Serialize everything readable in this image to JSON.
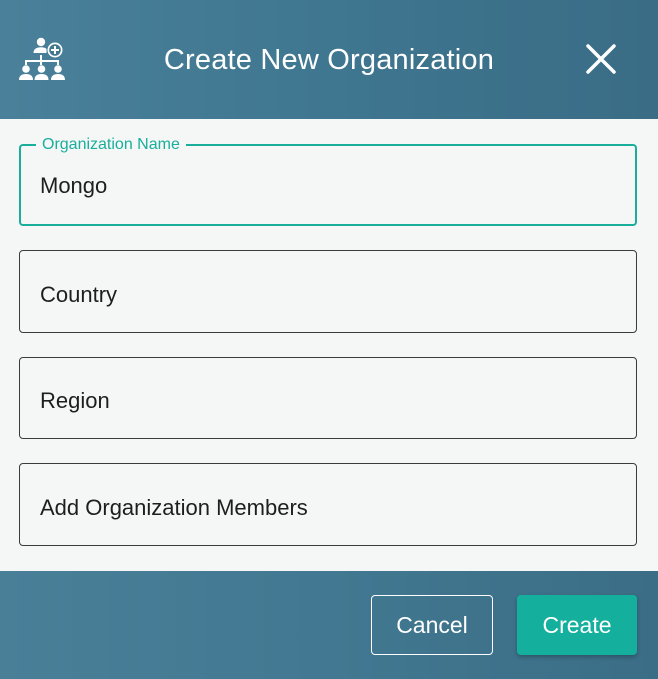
{
  "header": {
    "title": "Create New Organization",
    "icon": "organization-add-icon",
    "close_icon": "close-icon"
  },
  "form": {
    "organization_name": {
      "label": "Organization Name",
      "value": "Mongo"
    },
    "country": {
      "placeholder": "Country"
    },
    "region": {
      "placeholder": "Region"
    },
    "members": {
      "placeholder": "Add Organization Members"
    }
  },
  "footer": {
    "cancel_label": "Cancel",
    "create_label": "Create"
  },
  "colors": {
    "header_bg": "#427891",
    "accent": "#1aae9c",
    "body_bg": "#f5f7f6"
  }
}
